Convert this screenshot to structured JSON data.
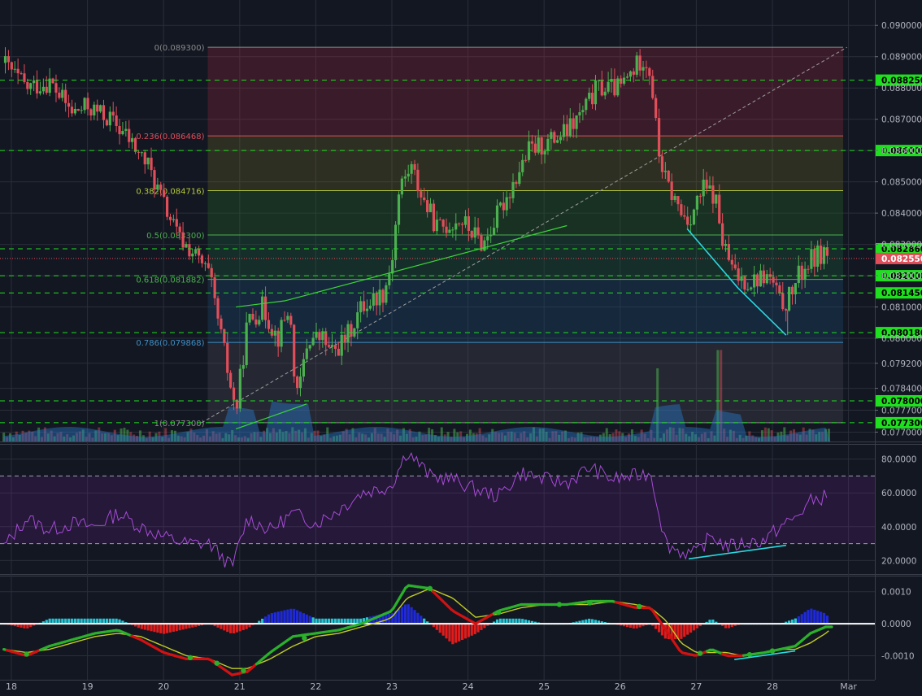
{
  "colors": {
    "background": "#131722",
    "grid": "#2a2e39",
    "up": "#4caf50",
    "down": "#e04e5a",
    "rsi": "#a64bd6",
    "rsi_band": "#7b1fa2",
    "macd_fast": "#2bb02b",
    "macd_slow": "#c2cc22",
    "hist_pos": "#29c4d4",
    "hist_neg": "#e01c1c",
    "level_line": "#1fe01f",
    "price_tag": "#e04e5a",
    "trend_cyan": "#29d8e0"
  },
  "chart_data": [
    {
      "type": "candlestick",
      "pane": "price",
      "x_ticks": [
        "18",
        "19",
        "20",
        "21",
        "22",
        "23",
        "24",
        "25",
        "26",
        "27",
        "28",
        "Mar"
      ],
      "y_range": [
        0.0767,
        0.0905
      ],
      "y_ticks": [
        "0.090000",
        "0.089000",
        "0.088000",
        "0.087000",
        "0.086000",
        "0.085000",
        "0.084000",
        "0.083000",
        "0.082000",
        "0.081000",
        "0.080000",
        "0.079200",
        "0.078400",
        "0.077700",
        "0.077000"
      ],
      "current_price": "0.082550",
      "horizontal_levels": [
        "0.088250",
        "0.086000",
        "0.082860",
        "0.082000",
        "0.081450",
        "0.080180",
        "0.078000",
        "0.077300"
      ],
      "fib_levels": [
        {
          "label": "0(0.089300)",
          "value": 0.0893,
          "color": "#8a8a8a"
        },
        {
          "label": "0.236(0.086468)",
          "value": 0.086468,
          "color": "#e04e5a"
        },
        {
          "label": "0.382(0.084716)",
          "value": 0.084716,
          "color": "#b5c93a"
        },
        {
          "label": "0.5(0.083300)",
          "value": 0.0833,
          "color": "#4caf50"
        },
        {
          "label": "0.618(0.081882)",
          "value": 0.081882,
          "color": "#4caf50"
        },
        {
          "label": "0.786(0.079868)",
          "value": 0.079868,
          "color": "#3f8fc4"
        },
        {
          "label": "1(0.077300)",
          "value": 0.0773,
          "color": "#8a8a8a"
        }
      ],
      "close_path": [
        [
          17.9,
          0.0888
        ],
        [
          18.2,
          0.088
        ],
        [
          18.5,
          0.0882
        ],
        [
          18.8,
          0.0872
        ],
        [
          19.0,
          0.0874
        ],
        [
          19.3,
          0.087
        ],
        [
          19.5,
          0.0865
        ],
        [
          19.8,
          0.0855
        ],
        [
          20.0,
          0.0843
        ],
        [
          20.2,
          0.0832
        ],
        [
          20.4,
          0.0827
        ],
        [
          20.6,
          0.082
        ],
        [
          20.8,
          0.0795
        ],
        [
          20.95,
          0.0776
        ],
        [
          21.1,
          0.0805
        ],
        [
          21.3,
          0.081
        ],
        [
          21.5,
          0.08
        ],
        [
          21.65,
          0.081
        ],
        [
          21.75,
          0.078
        ],
        [
          21.9,
          0.08
        ],
        [
          22.1,
          0.08
        ],
        [
          22.2,
          0.0795
        ],
        [
          22.4,
          0.08
        ],
        [
          22.6,
          0.081
        ],
        [
          22.9,
          0.0815
        ],
        [
          23.0,
          0.0825
        ],
        [
          23.1,
          0.0848
        ],
        [
          23.25,
          0.0855
        ],
        [
          23.4,
          0.0845
        ],
        [
          23.6,
          0.0835
        ],
        [
          23.9,
          0.0838
        ],
        [
          24.2,
          0.083
        ],
        [
          24.4,
          0.084
        ],
        [
          24.6,
          0.085
        ],
        [
          24.8,
          0.086
        ],
        [
          25.0,
          0.0862
        ],
        [
          25.3,
          0.0866
        ],
        [
          25.5,
          0.0872
        ],
        [
          25.7,
          0.088
        ],
        [
          26.0,
          0.088
        ],
        [
          26.3,
          0.089
        ],
        [
          26.4,
          0.0885
        ],
        [
          26.5,
          0.086
        ],
        [
          26.6,
          0.085
        ],
        [
          26.8,
          0.084
        ],
        [
          26.9,
          0.0838
        ],
        [
          27.1,
          0.0848
        ],
        [
          27.25,
          0.0845
        ],
        [
          27.35,
          0.083
        ],
        [
          27.5,
          0.082
        ],
        [
          27.7,
          0.0818
        ],
        [
          27.9,
          0.082
        ],
        [
          28.0,
          0.0818
        ],
        [
          28.1,
          0.0811
        ],
        [
          28.2,
          0.0812
        ],
        [
          28.35,
          0.082
        ],
        [
          28.5,
          0.0825
        ],
        [
          28.7,
          0.0828
        ],
        [
          28.75,
          0.08255
        ]
      ],
      "volume_spikes": [
        [
          26.5,
          0.6
        ],
        [
          27.3,
          0.75
        ]
      ]
    },
    {
      "type": "line",
      "pane": "rsi",
      "y_range": [
        12,
        88
      ],
      "y_ticks": [
        "80.0000",
        "60.0000",
        "40.0000",
        "20.0000"
      ],
      "bands": [
        30,
        70
      ],
      "x": [
        17.9,
        18.2,
        18.5,
        18.8,
        19.1,
        19.4,
        19.7,
        20.0,
        20.3,
        20.6,
        20.9,
        21.1,
        21.4,
        21.7,
        22.0,
        22.3,
        22.6,
        22.9,
        23.0,
        23.2,
        23.5,
        23.8,
        24.1,
        24.4,
        24.7,
        25.0,
        25.3,
        25.6,
        25.9,
        26.2,
        26.4,
        26.6,
        26.8,
        27.0,
        27.2,
        27.4,
        27.6,
        27.9,
        28.1,
        28.3,
        28.5,
        28.7,
        28.75
      ],
      "values": [
        28,
        45,
        38,
        42,
        40,
        48,
        40,
        34,
        30,
        30,
        16,
        45,
        38,
        48,
        42,
        50,
        60,
        63,
        65,
        85,
        70,
        68,
        62,
        58,
        72,
        68,
        66,
        75,
        68,
        70,
        72,
        30,
        25,
        24,
        35,
        28,
        30,
        32,
        40,
        45,
        55,
        58,
        52
      ]
    },
    {
      "type": "line",
      "pane": "macd",
      "y_range": [
        -0.00175,
        0.00145
      ],
      "y_ticks": [
        "0.0010",
        "0.0000",
        "-0.0010"
      ],
      "x": [
        17.9,
        18.2,
        18.5,
        18.8,
        19.1,
        19.4,
        19.7,
        20.0,
        20.3,
        20.6,
        20.9,
        21.1,
        21.4,
        21.7,
        22.0,
        22.3,
        22.6,
        22.9,
        23.0,
        23.2,
        23.5,
        23.8,
        24.1,
        24.4,
        24.7,
        25.0,
        25.3,
        25.6,
        25.9,
        26.2,
        26.4,
        26.6,
        26.8,
        27.0,
        27.2,
        27.4,
        27.6,
        27.9,
        28.1,
        28.3,
        28.5,
        28.7,
        28.75
      ],
      "macd": [
        -0.0008,
        -0.001,
        -0.0007,
        -0.0005,
        -0.0003,
        -0.0002,
        -0.0005,
        -0.0009,
        -0.0011,
        -0.0011,
        -0.0016,
        -0.0015,
        -0.0009,
        -0.0004,
        -0.0003,
        -0.0002,
        0.0,
        0.0003,
        0.0004,
        0.0012,
        0.0011,
        0.0004,
        0.0,
        0.0004,
        0.0006,
        0.0006,
        0.0006,
        0.0007,
        0.0007,
        0.0005,
        0.0005,
        -0.0002,
        -0.0009,
        -0.001,
        -0.0008,
        -0.001,
        -0.001,
        -0.0009,
        -0.0008,
        -0.0007,
        -0.0003,
        -0.0001,
        -0.0001
      ],
      "signal": [
        -0.0008,
        -0.0009,
        -0.0008,
        -0.0006,
        -0.0004,
        -0.0003,
        -0.0004,
        -0.0007,
        -0.001,
        -0.0011,
        -0.0014,
        -0.0014,
        -0.0011,
        -0.0007,
        -0.0004,
        -0.0003,
        -0.0001,
        0.0001,
        0.0002,
        0.0008,
        0.0011,
        0.0008,
        0.0002,
        0.0003,
        0.0005,
        0.0006,
        0.0006,
        0.0006,
        0.0007,
        0.0006,
        0.0005,
        0.0001,
        -0.0006,
        -0.0009,
        -0.0009,
        -0.0009,
        -0.001,
        -0.0009,
        -0.0008,
        -0.0008,
        -0.0006,
        -0.0003,
        -0.0002
      ]
    }
  ]
}
